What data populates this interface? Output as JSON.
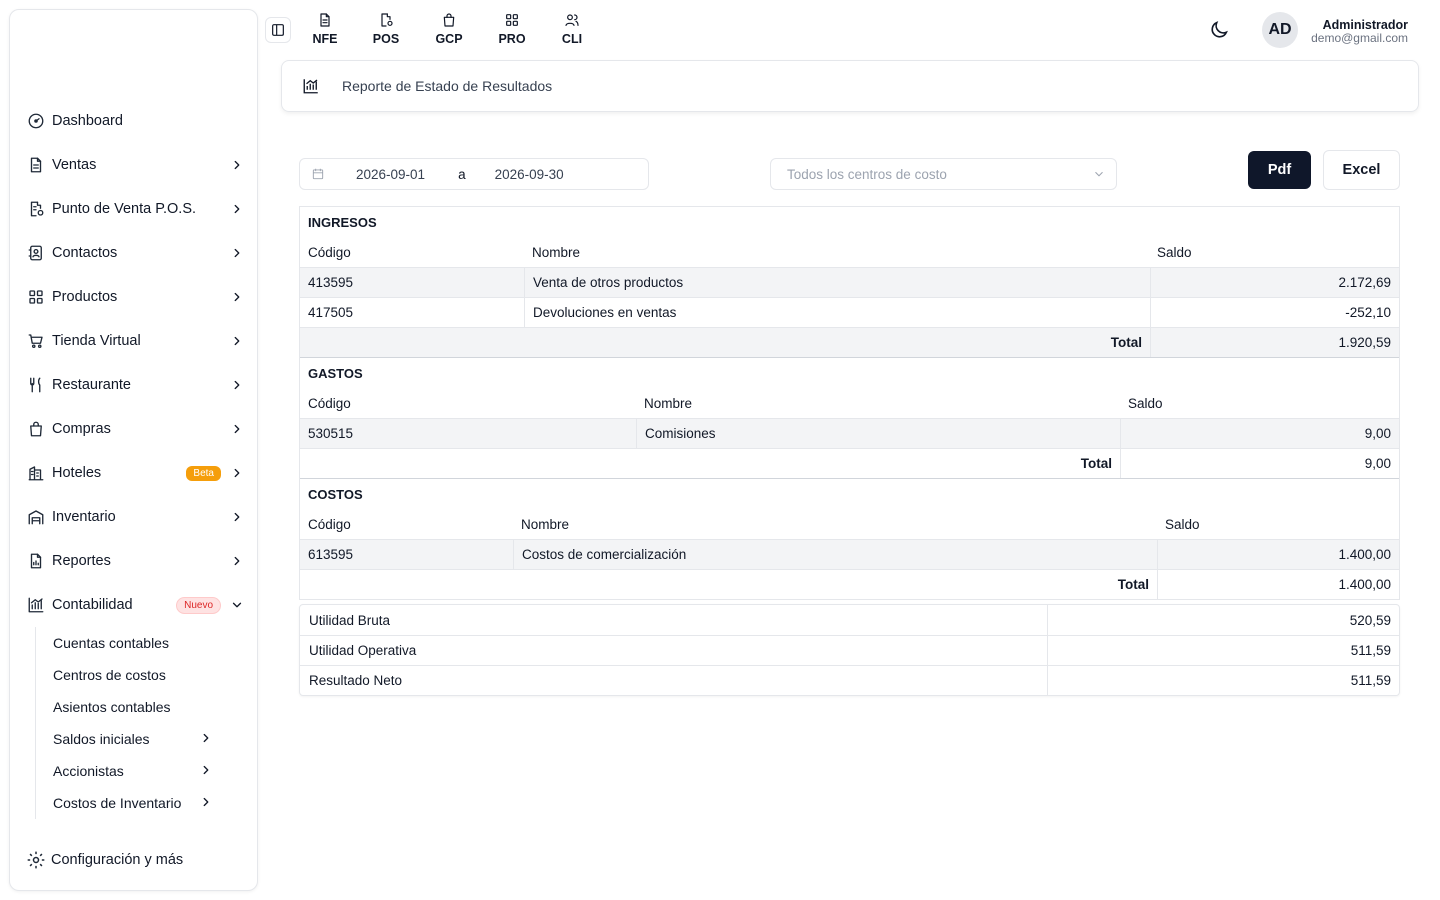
{
  "sidebar": {
    "items": [
      {
        "label": "Dashboard",
        "icon": "gauge-icon"
      },
      {
        "label": "Ventas",
        "icon": "document-icon"
      },
      {
        "label": "Punto de Venta P.O.S.",
        "icon": "pos-receipt-icon"
      },
      {
        "label": "Contactos",
        "icon": "contacts-icon"
      },
      {
        "label": "Productos",
        "icon": "grid-icon"
      },
      {
        "label": "Tienda Virtual",
        "icon": "cart-icon"
      },
      {
        "label": "Restaurante",
        "icon": "utensils-icon"
      },
      {
        "label": "Compras",
        "icon": "shopping-bag-icon"
      },
      {
        "label": "Hoteles",
        "icon": "hotel-icon",
        "badge": "Beta"
      },
      {
        "label": "Inventario",
        "icon": "warehouse-icon"
      },
      {
        "label": "Reportes",
        "icon": "report-icon"
      },
      {
        "label": "Contabilidad",
        "icon": "chart-icon",
        "badge": "Nuevo"
      }
    ],
    "sub_items": [
      {
        "label": "Cuentas contables"
      },
      {
        "label": "Centros de costos"
      },
      {
        "label": "Asientos contables"
      },
      {
        "label": "Saldos iniciales"
      },
      {
        "label": "Accionistas"
      },
      {
        "label": "Costos de Inventario"
      }
    ],
    "config_label": "Configuración y más"
  },
  "topbar": {
    "modules": [
      "NFE",
      "POS",
      "GCP",
      "PRO",
      "CLI"
    ],
    "avatar_initials": "AD",
    "user_name": "Administrador",
    "user_email": "demo@gmail.com"
  },
  "header": {
    "title": "Reporte de Estado de Resultados"
  },
  "filters": {
    "date_from": "2026-09-01",
    "date_separator": "a",
    "date_to": "2026-09-30",
    "cost_center_placeholder": "Todos los centros de costo",
    "pdf_label": "Pdf",
    "excel_label": "Excel"
  },
  "report": {
    "ingresos": {
      "title": "INGRESOS",
      "headers": [
        "Código",
        "Nombre",
        "Saldo"
      ],
      "rows": [
        {
          "code": "413595",
          "name": "Venta de otros productos",
          "saldo": "2.172,69"
        },
        {
          "code": "417505",
          "name": "Devoluciones en ventas",
          "saldo": "-252,10"
        }
      ],
      "total_label": "Total",
      "total": "1.920,59"
    },
    "gastos": {
      "title": "GASTOS",
      "headers": [
        "Código",
        "Nombre",
        "Saldo"
      ],
      "rows": [
        {
          "code": "530515",
          "name": "Comisiones",
          "saldo": "9,00"
        }
      ],
      "total_label": "Total",
      "total": "9,00"
    },
    "costos": {
      "title": "COSTOS",
      "headers": [
        "Código",
        "Nombre",
        "Saldo"
      ],
      "rows": [
        {
          "code": "613595",
          "name": "Costos de comercialización",
          "saldo": "1.400,00"
        }
      ],
      "total_label": "Total",
      "total": "1.400,00"
    }
  },
  "summary": [
    {
      "label": "Utilidad Bruta",
      "value": "520,59"
    },
    {
      "label": "Utilidad Operativa",
      "value": "511,59"
    },
    {
      "label": "Resultado Neto",
      "value": "511,59"
    }
  ]
}
